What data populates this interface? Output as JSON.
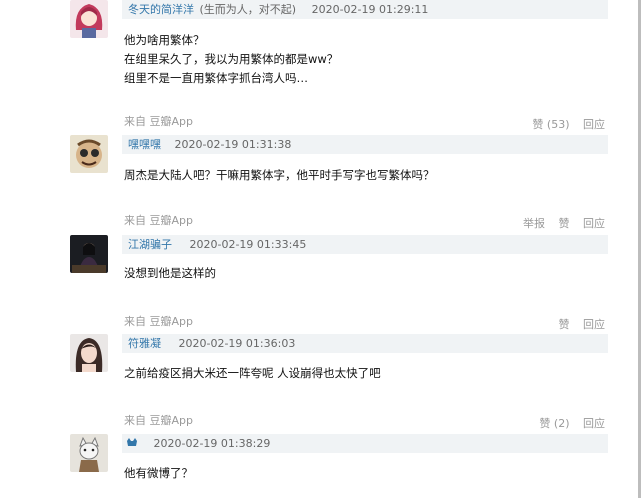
{
  "comments": [
    {
      "author": "冬天的简洋洋",
      "signature": "(生而为人，对不起)",
      "time": "2020-02-19 01:29:11",
      "lines": [
        "他为啥用繁体？",
        "在组里呆久了，我以为用繁体的都是ww？",
        "组里不是一直用繁体字抓台湾人吗…"
      ],
      "source": "来自 豆瓣App",
      "actions": {
        "report": "",
        "like": "赞 (53)",
        "reply": "回应"
      }
    },
    {
      "author": "嘿嘿嘿",
      "signature": "",
      "time": "2020-02-19 01:31:38",
      "lines": [
        "周杰是大陆人吧？干嘛用繁体字，他平时手写字也写繁体吗？"
      ],
      "source": "来自 豆瓣App",
      "actions": {
        "report": "举报",
        "like": "赞",
        "reply": "回应"
      }
    },
    {
      "author": "江湖骗子",
      "signature": "",
      "time": "2020-02-19 01:33:45",
      "lines": [
        "没想到他是这样的"
      ],
      "source": "来自 豆瓣App",
      "actions": {
        "report": "",
        "like": "赞",
        "reply": "回应"
      }
    },
    {
      "author": "符雅凝",
      "signature": "",
      "time": "2020-02-19 01:36:03",
      "lines": [
        "之前给疫区捐大米还一阵夸呢 人设崩得也太快了吧"
      ],
      "source": "来自 豆瓣App",
      "actions": {
        "report": "",
        "like": "赞 (2)",
        "reply": "回应"
      }
    },
    {
      "author": "",
      "signature": "",
      "time": "2020-02-19 01:38:29",
      "lines": [
        "他有微博了？"
      ],
      "source": "",
      "actions": {
        "report": "",
        "like": "",
        "reply": ""
      }
    }
  ],
  "colors": {
    "accent": "#3377aa",
    "header_bg": "#f0f3f5",
    "muted": "#999999"
  }
}
